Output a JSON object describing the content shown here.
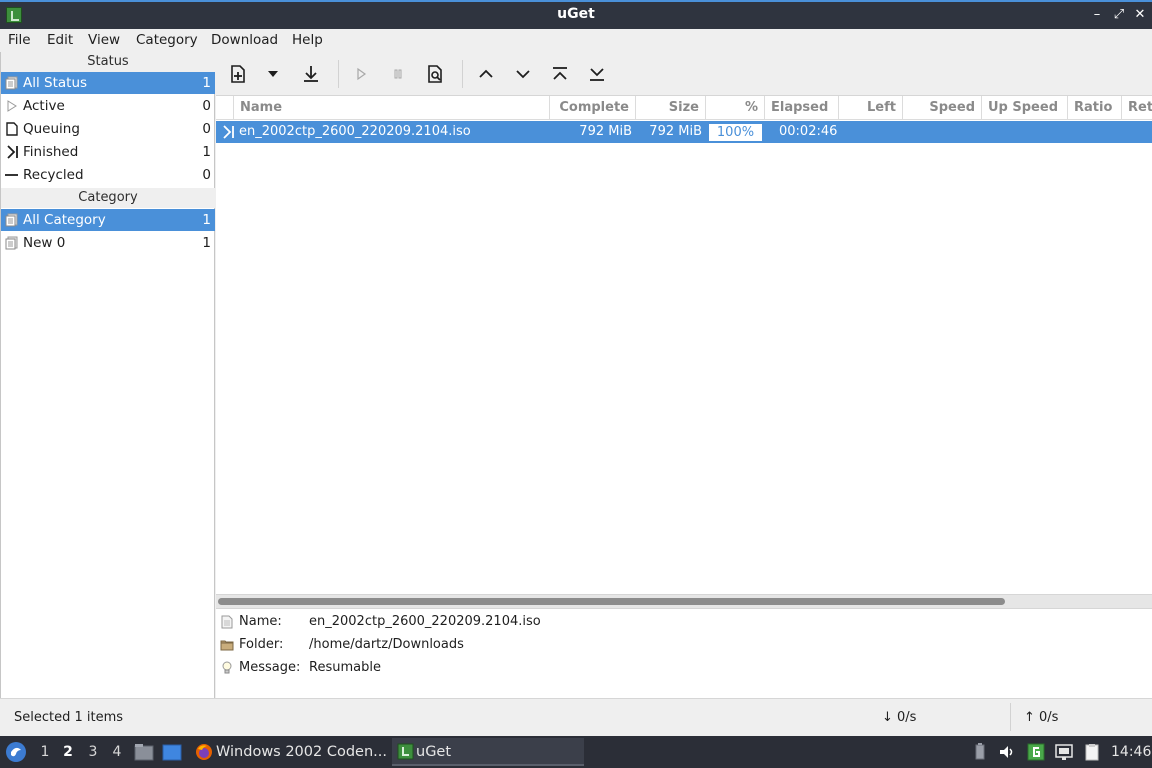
{
  "window": {
    "title": "uGet"
  },
  "menu": [
    "File",
    "Edit",
    "View",
    "Category",
    "Download",
    "Help"
  ],
  "sidebar": {
    "status_header": "Status",
    "status_items": [
      {
        "label": "All Status",
        "count": "1",
        "selected": true
      },
      {
        "label": "Active",
        "count": "0"
      },
      {
        "label": "Queuing",
        "count": "0"
      },
      {
        "label": "Finished",
        "count": "1"
      },
      {
        "label": "Recycled",
        "count": "0"
      }
    ],
    "category_header": "Category",
    "category_items": [
      {
        "label": "All Category",
        "count": "1",
        "selected": true
      },
      {
        "label": "New 0",
        "count": "1"
      }
    ]
  },
  "table": {
    "columns": [
      "Name",
      "Complete",
      "Size",
      "%",
      "Elapsed",
      "Left",
      "Speed",
      "Up Speed",
      "Ratio",
      "Ret"
    ],
    "rows": [
      {
        "name": "en_2002ctp_2600_220209.2104.iso",
        "complete": "792 MiB",
        "size": "792 MiB",
        "percent": "100%",
        "progress": 1.0,
        "elapsed": "00:02:46",
        "left": "",
        "speed": "",
        "up_speed": "",
        "ratio": ""
      }
    ]
  },
  "details": {
    "name_label": "Name:",
    "name_value": "en_2002ctp_2600_220209.2104.iso",
    "folder_label": "Folder:",
    "folder_value": "/home/dartz/Downloads",
    "message_label": "Message:",
    "message_value": "Resumable"
  },
  "statusbar": {
    "selected": "Selected 1 items",
    "down_speed": "↓  0/s",
    "up_speed": "↑  0/s"
  },
  "taskbar": {
    "workspaces": [
      "1",
      "2",
      "3",
      "4"
    ],
    "current_workspace": "2",
    "tasks": [
      {
        "label": "Windows 2002 Coden...",
        "icon": "firefox-icon"
      },
      {
        "label": "uGet",
        "icon": "uget-icon"
      }
    ],
    "clock": "14:46"
  },
  "colors": {
    "accent": "#4a90d9",
    "titlebar": "#2f343f",
    "taskbar": "#2b2e37"
  }
}
